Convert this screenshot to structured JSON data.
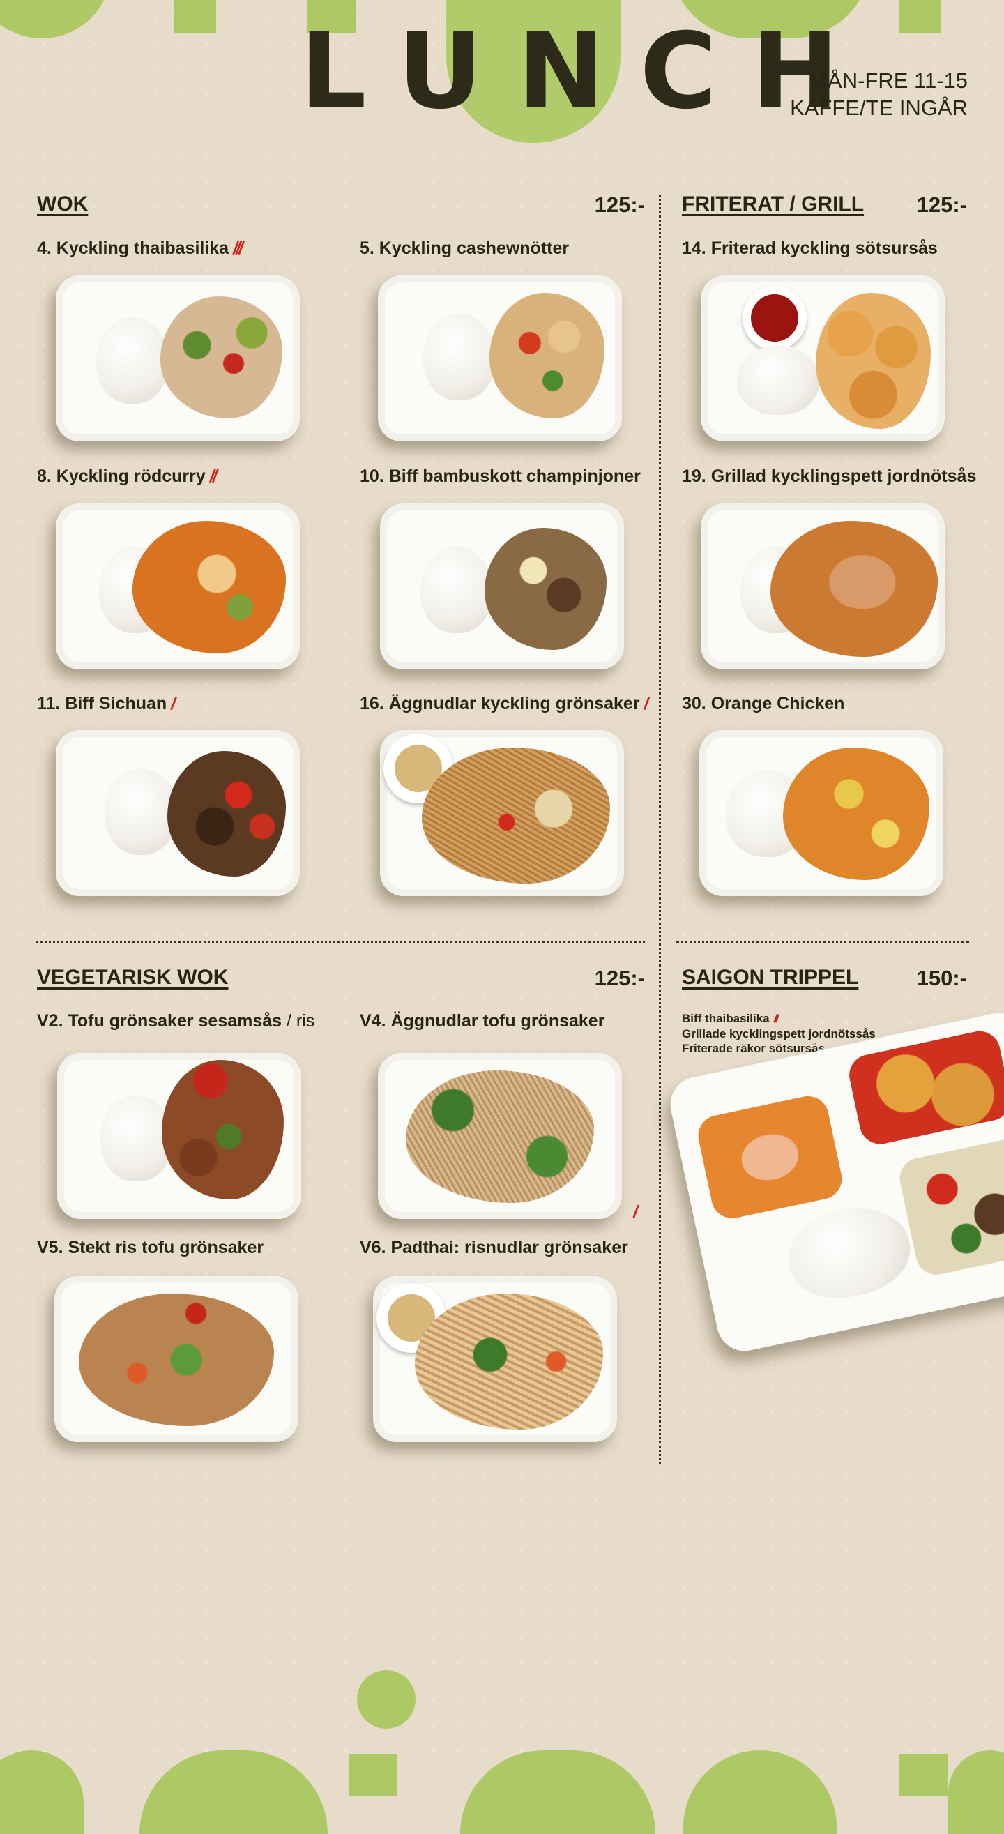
{
  "header": {
    "title": "LUNCH",
    "hours": "MÅN-FRE 11-15",
    "included": "KAFFE/TE INGÅR"
  },
  "colors": {
    "accent_green": "#adc965",
    "background": "#e6dcc9",
    "chili_red": "#d0231a"
  },
  "sections": {
    "wok": {
      "title": "WOK",
      "price": "125:-",
      "dishes": [
        {
          "name": "4. Kyckling thaibasilika",
          "spice": 3
        },
        {
          "name": "5. Kyckling cashewnötter",
          "spice": 0
        },
        {
          "name": "8. Kyckling rödcurry",
          "spice": 2
        },
        {
          "name": "10. Biff bambuskott champinjoner",
          "spice": 0
        },
        {
          "name": "11. Biff Sichuan",
          "spice": 1
        },
        {
          "name": "16. Äggnudlar kyckling grönsaker",
          "spice": 1
        }
      ]
    },
    "friterat": {
      "title": "FRITERAT / GRILL",
      "price": "125:-",
      "dishes": [
        {
          "name": "14. Friterad kyckling sötsursås",
          "spice": 0
        },
        {
          "name": "19. Grillad kycklingspett jordnötsås",
          "spice": 0
        },
        {
          "name": "30. Orange Chicken",
          "spice": 0
        }
      ]
    },
    "vegetarisk": {
      "title": "VEGETARISK WOK",
      "price": "125:-",
      "dishes": [
        {
          "name": "V2. Tofu grönsaker sesamsås",
          "suffix": " / ris",
          "spice": 0
        },
        {
          "name": "V4. Äggnudlar tofu grönsaker",
          "spice": 1
        },
        {
          "name": "V5.  Stekt ris tofu grönsaker",
          "spice": 0
        },
        {
          "name": "V6.  Padthai: risnudlar grönsaker",
          "spice": 0
        }
      ]
    },
    "trippel": {
      "title": "SAIGON TRIPPEL",
      "price": "150:-",
      "items": [
        {
          "name": "Biff thaibasilika",
          "spice": 3
        },
        {
          "name": "Grillade kycklingspett jordnötssås",
          "spice": 0
        },
        {
          "name": "Friterade räkor sötsursås",
          "spice": 0
        }
      ]
    }
  },
  "icons": {
    "chili": "chili-pepper-icon"
  }
}
